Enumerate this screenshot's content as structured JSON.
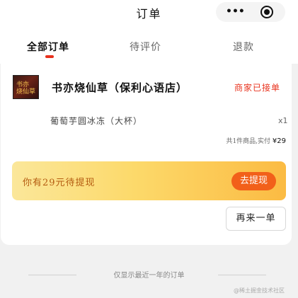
{
  "nav": {
    "title": "订单",
    "more_icon": "•••",
    "close_icon": "record-circle-icon"
  },
  "tabs": [
    {
      "label": "全部订单",
      "active": true
    },
    {
      "label": "待评价",
      "active": false
    },
    {
      "label": "退款",
      "active": false
    }
  ],
  "order": {
    "shop_logo_text": "书亦\n烧仙草",
    "shop_name": "书亦烧仙草（保利心语店）",
    "status": "商家已接单",
    "item_name": "葡萄芋圆冰冻（大杯）",
    "item_qty": "x1",
    "summary_prefix": "共1件商品,实付",
    "summary_price": "¥29",
    "promo_text": "你有29元待提现",
    "promo_button": "去提现",
    "reorder_button": "再来一单"
  },
  "footer": {
    "note": "仅显示最近一年的订单",
    "watermark": "@稀土掘金技术社区"
  },
  "colors": {
    "accent": "#e8321d",
    "promo_button": "#f2601a",
    "promo_text": "#b45b10"
  }
}
